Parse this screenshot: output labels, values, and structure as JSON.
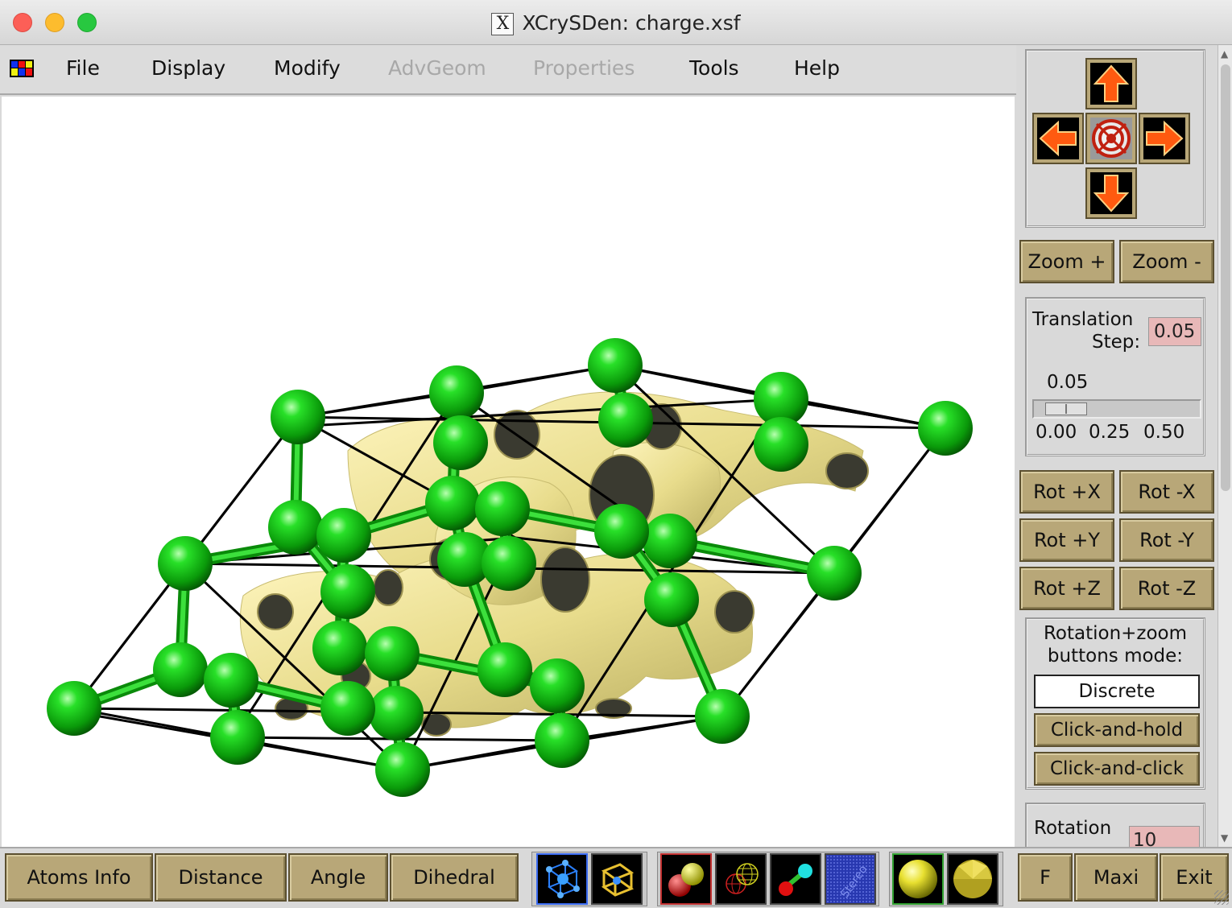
{
  "window": {
    "title": "XCrySDen: charge.xsf",
    "x_logo": "X"
  },
  "menu": {
    "file": "File",
    "display": "Display",
    "modify": "Modify",
    "advgeom": "AdvGeom",
    "properties": "Properties",
    "tools": "Tools",
    "help": "Help"
  },
  "icons": {
    "app": "app-flag-icon",
    "nav_up": "arrow-up-icon",
    "nav_down": "arrow-down-icon",
    "nav_left": "arrow-left-icon",
    "nav_right": "arrow-right-icon",
    "nav_center": "center-target-icon"
  },
  "colors": {
    "atom": "#10c010",
    "bond": "#18b818",
    "isosurface": "#efe6a0",
    "cell_edges": "#000000",
    "button_face": "#b8a778",
    "entry_bg": "#e8b8b8"
  },
  "right_panel": {
    "zoom_in": "Zoom +",
    "zoom_out": "Zoom -",
    "translation_label_1": "Translation",
    "translation_label_2": "Step:",
    "translation_value": "0.05",
    "slider_value": "0.05",
    "slider_fraction": 0.1,
    "slider_tick_0": "0.00",
    "slider_tick_1": "0.25",
    "slider_tick_2": "0.50",
    "rot_px": "Rot +X",
    "rot_mx": "Rot -X",
    "rot_py": "Rot +Y",
    "rot_my": "Rot -Y",
    "rot_pz": "Rot +Z",
    "rot_mz": "Rot -Z",
    "mode_label_1": "Rotation+zoom",
    "mode_label_2": "buttons mode:",
    "mode_discrete": "Discrete",
    "mode_click_hold": "Click-and-hold",
    "mode_click_click": "Click-and-click",
    "rotation_step_label": "Rotation",
    "rotation_step_value": "10"
  },
  "bottom_bar": {
    "atoms_info": "Atoms Info",
    "distance": "Distance",
    "angle": "Angle",
    "dihedral": "Dihedral",
    "stereo": "Stereo",
    "f": "F",
    "maxi": "Maxi",
    "exit": "Exit"
  }
}
